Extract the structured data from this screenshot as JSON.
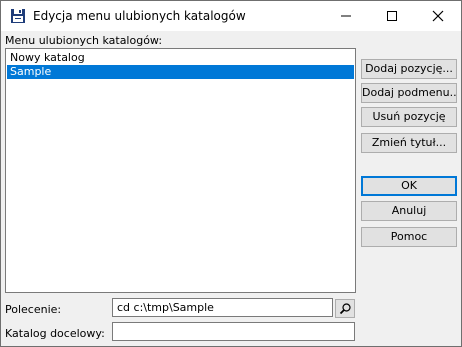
{
  "window": {
    "title": "Edycja menu ulubionych katalogów",
    "icon": "floppy-disk-icon"
  },
  "list": {
    "label": "Menu ulubionych katalogów:",
    "items": [
      {
        "label": "Nowy katalog",
        "selected": false
      },
      {
        "label": "Sample",
        "selected": true
      }
    ]
  },
  "buttons": {
    "add_item": "Dodaj pozycję...",
    "add_submenu": "Dodaj podmenu...",
    "remove_item": "Usuń pozycję",
    "rename": "Zmień tytuł...",
    "ok": "OK",
    "cancel": "Anuluj",
    "help": "Pomoc"
  },
  "command": {
    "label": "Polecenie:",
    "value": "cd c:\\tmp\\Sample"
  },
  "target": {
    "label": "Katalog docelowy:",
    "value": ""
  },
  "colors": {
    "selection": "#0078d7",
    "button_face": "#e1e1e1"
  }
}
